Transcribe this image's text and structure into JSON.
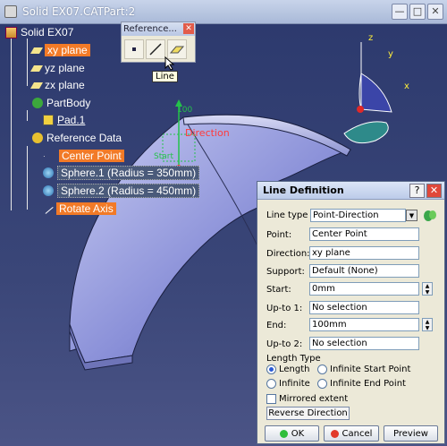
{
  "window": {
    "title": "Solid EX07.CATPart:2"
  },
  "tree": {
    "root": "Solid EX07",
    "xy": "xy plane",
    "yz": "yz plane",
    "zx": "zx plane",
    "partbody": "PartBody",
    "pad": "Pad.1",
    "refdata": "Reference Data",
    "center": "Center Point",
    "sphere1": "Sphere.1 (Radius = 350mm)",
    "sphere2": "Sphere.2 (Radius = 450mm)",
    "rotate": "Rotate Axis"
  },
  "toolbar": {
    "title": "Reference...",
    "tooltip": "Line"
  },
  "viewport": {
    "start_label": "Start",
    "dir_label": "Direction",
    "dim_label": "100",
    "axis_z": "z",
    "axis_y": "y",
    "axis_x": "x"
  },
  "dialog": {
    "title": "Line Definition",
    "line_type_label": "Line type :",
    "line_type_value": "Point-Direction",
    "point_label": "Point:",
    "point_value": "Center Point",
    "direction_label": "Direction:",
    "direction_value": "xy plane",
    "support_label": "Support:",
    "support_value": "Default (None)",
    "start_label": "Start:",
    "start_value": "0mm",
    "upto1_label": "Up-to 1:",
    "upto1_value": "No selection",
    "end_label": "End:",
    "end_value": "100mm",
    "upto2_label": "Up-to 2:",
    "upto2_value": "No selection",
    "length_type_label": "Length Type",
    "opt_length": "Length",
    "opt_inf_start": "Infinite Start Point",
    "opt_infinite": "Infinite",
    "opt_inf_end": "Infinite End Point",
    "mirrored": "Mirrored extent",
    "reverse": "Reverse Direction",
    "ok": "OK",
    "cancel": "Cancel",
    "preview": "Preview"
  }
}
